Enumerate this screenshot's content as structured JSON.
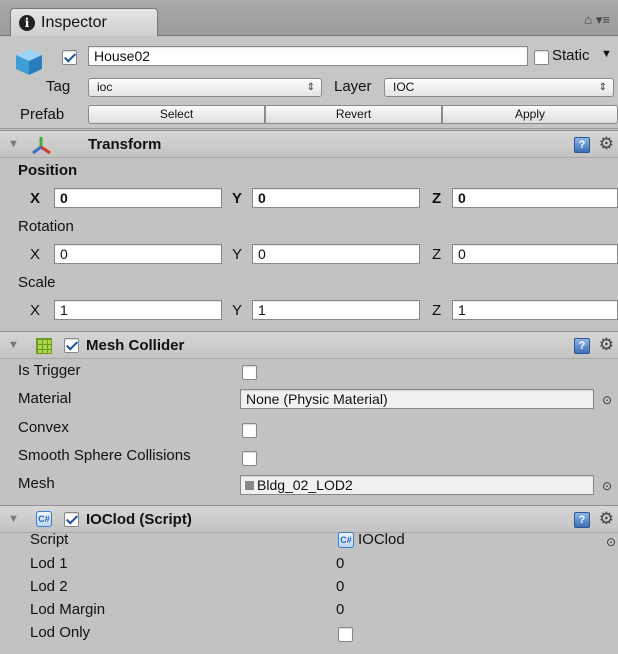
{
  "tab": {
    "icon": "info-icon",
    "title": "Inspector",
    "tools": "⌂ ▾≡"
  },
  "object": {
    "name": "House02",
    "static_label": "Static",
    "tag_label": "Tag",
    "tag_value": "ioc",
    "layer_label": "Layer",
    "layer_value": "IOC",
    "prefab_label": "Prefab",
    "buttons": [
      "Select",
      "Revert",
      "Apply"
    ]
  },
  "transform": {
    "title": "Transform",
    "position_label": "Position",
    "rotation_label": "Rotation",
    "scale_label": "Scale",
    "axes": [
      "X",
      "Y",
      "Z"
    ],
    "position": [
      "0",
      "0",
      "0"
    ],
    "rotation": [
      "0",
      "0",
      "0"
    ],
    "scale": [
      "1",
      "1",
      "1"
    ]
  },
  "mesh_collider": {
    "title": "Mesh Collider",
    "is_trigger_label": "Is Trigger",
    "material_label": "Material",
    "material_value": "None (Physic Material)",
    "convex_label": "Convex",
    "smooth_label": "Smooth Sphere Collisions",
    "mesh_label": "Mesh",
    "mesh_value": "Bldg_02_LOD2"
  },
  "ioclod": {
    "title": "IOClod (Script)",
    "script_label": "Script",
    "script_value": "IOClod",
    "lod1_label": "Lod 1",
    "lod1_value": "0",
    "lod2_label": "Lod 2",
    "lod2_value": "0",
    "lod_margin_label": "Lod Margin",
    "lod_margin_value": "0",
    "lod_only_label": "Lod Only"
  },
  "colors": {
    "panel": "#c2c2c2",
    "header": "#c9c9c9",
    "accent": "#3e6fb5"
  }
}
